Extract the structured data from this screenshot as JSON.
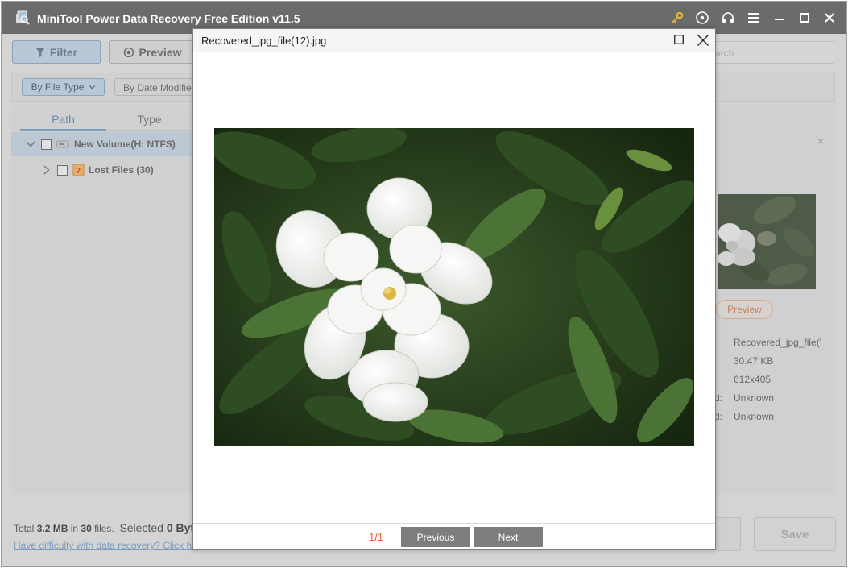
{
  "app": {
    "title": "MiniTool Power Data Recovery Free Edition v11.5",
    "title_icons": [
      "key-icon",
      "disc-icon",
      "headset-icon",
      "menu-icon",
      "minimize-icon",
      "maximize-icon",
      "close-icon"
    ]
  },
  "toolbar": {
    "filter_label": "Filter",
    "preview_label": "Preview",
    "search_placeholder": "arch"
  },
  "filters": {
    "by_file_type": "By File Type",
    "by_date_modified": "By Date Modified"
  },
  "tree": {
    "tabs": [
      {
        "label": "Path",
        "active": true
      },
      {
        "label": "Type",
        "active": false
      }
    ],
    "items": [
      {
        "label": "New Volume(H: NTFS)",
        "expanded": true,
        "selected": true
      },
      {
        "label": "Lost Files (30)",
        "expanded": false,
        "selected": false
      }
    ]
  },
  "details": {
    "preview_button": "Preview",
    "rows": [
      {
        "key": "",
        "value": "Recovered_jpg_file('"
      },
      {
        "key": "",
        "value": "30.47 KB"
      },
      {
        "key": "",
        "value": "612x405"
      },
      {
        "key": "d:",
        "value": "Unknown"
      },
      {
        "key": "d:",
        "value": "Unknown"
      }
    ]
  },
  "footer": {
    "total_prefix": "Total ",
    "total_size": "3.2 MB",
    "total_mid": " in ",
    "total_count": "30",
    "total_suffix": " files.",
    "selected_prefix": "Selected ",
    "selected_value": "0 Byt",
    "help_link": "Have difficulty with data recovery? Click h",
    "save_label": "Save"
  },
  "modal": {
    "title": "Recovered_jpg_file(12).jpg",
    "pager": "1/1",
    "previous_label": "Previous",
    "next_label": "Next"
  },
  "colors": {
    "titlebar": "#6b6b6b",
    "accent_blue": "#7d9dbb",
    "pager_orange": "#e0662a",
    "nav_button": "#7d7d7d"
  }
}
